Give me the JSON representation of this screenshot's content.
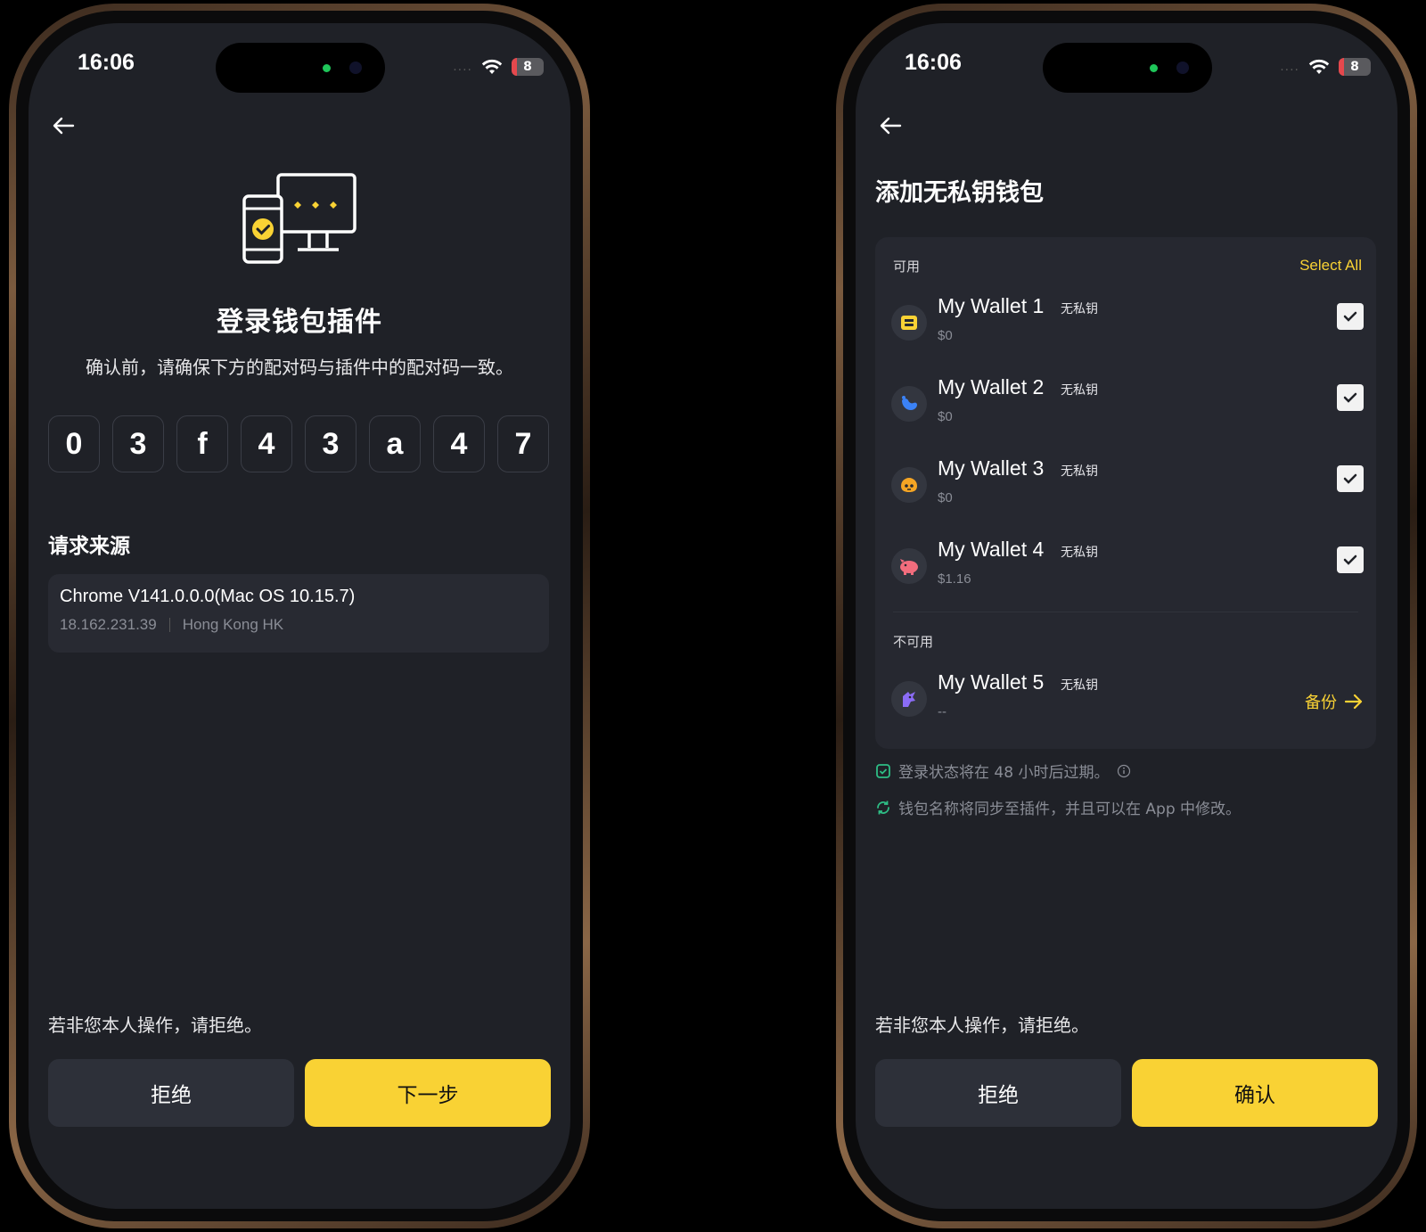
{
  "status_bar": {
    "time": "16:06",
    "battery": "8",
    "signal_dots": "...."
  },
  "left": {
    "title": "登录钱包插件",
    "subtitle": "确认前，请确保下方的配对码与插件中的配对码一致。",
    "pair_code": [
      "0",
      "3",
      "f",
      "4",
      "3",
      "a",
      "4",
      "7"
    ],
    "source_title": "请求来源",
    "source": {
      "browser": "Chrome V141.0.0.0(Mac OS 10.15.7)",
      "ip": "18.162.231.39",
      "location": "Hong Kong HK"
    },
    "warning": "若非您本人操作，请拒绝。",
    "reject_label": "拒绝",
    "next_label": "下一步"
  },
  "right": {
    "title": "添加无私钥钱包",
    "available_label": "可用",
    "select_all_label": "Select All",
    "wallets": [
      {
        "name": "My Wallet 1",
        "tag": "无私钥",
        "balance": "$0",
        "checked": true,
        "icon": "yellow-wallet-icon"
      },
      {
        "name": "My Wallet 2",
        "tag": "无私钥",
        "balance": "$0",
        "checked": true,
        "icon": "blue-whale-icon"
      },
      {
        "name": "My Wallet 3",
        "tag": "无私钥",
        "balance": "$0",
        "checked": true,
        "icon": "orange-face-icon"
      },
      {
        "name": "My Wallet 4",
        "tag": "无私钥",
        "balance": "$1.16",
        "checked": true,
        "icon": "pink-pig-icon"
      }
    ],
    "unavailable_label": "不可用",
    "unavailable_wallets": [
      {
        "name": "My Wallet 5",
        "tag": "无私钥",
        "balance": "--",
        "icon": "purple-unicorn-icon"
      }
    ],
    "backup_label": "备份",
    "notes": [
      {
        "text": "登录状态将在 48 小时后过期。",
        "icon": "shield-check-icon"
      },
      {
        "text": "钱包名称将同步至插件，并且可以在 App 中修改。",
        "icon": "sync-icon"
      }
    ],
    "warning": "若非您本人操作，请拒绝。",
    "reject_label": "拒绝",
    "confirm_label": "确认"
  },
  "colors": {
    "accent": "#f9d234",
    "screen_bg": "#1f2127",
    "card_bg": "#262830",
    "note_green": "#2ebd85"
  }
}
